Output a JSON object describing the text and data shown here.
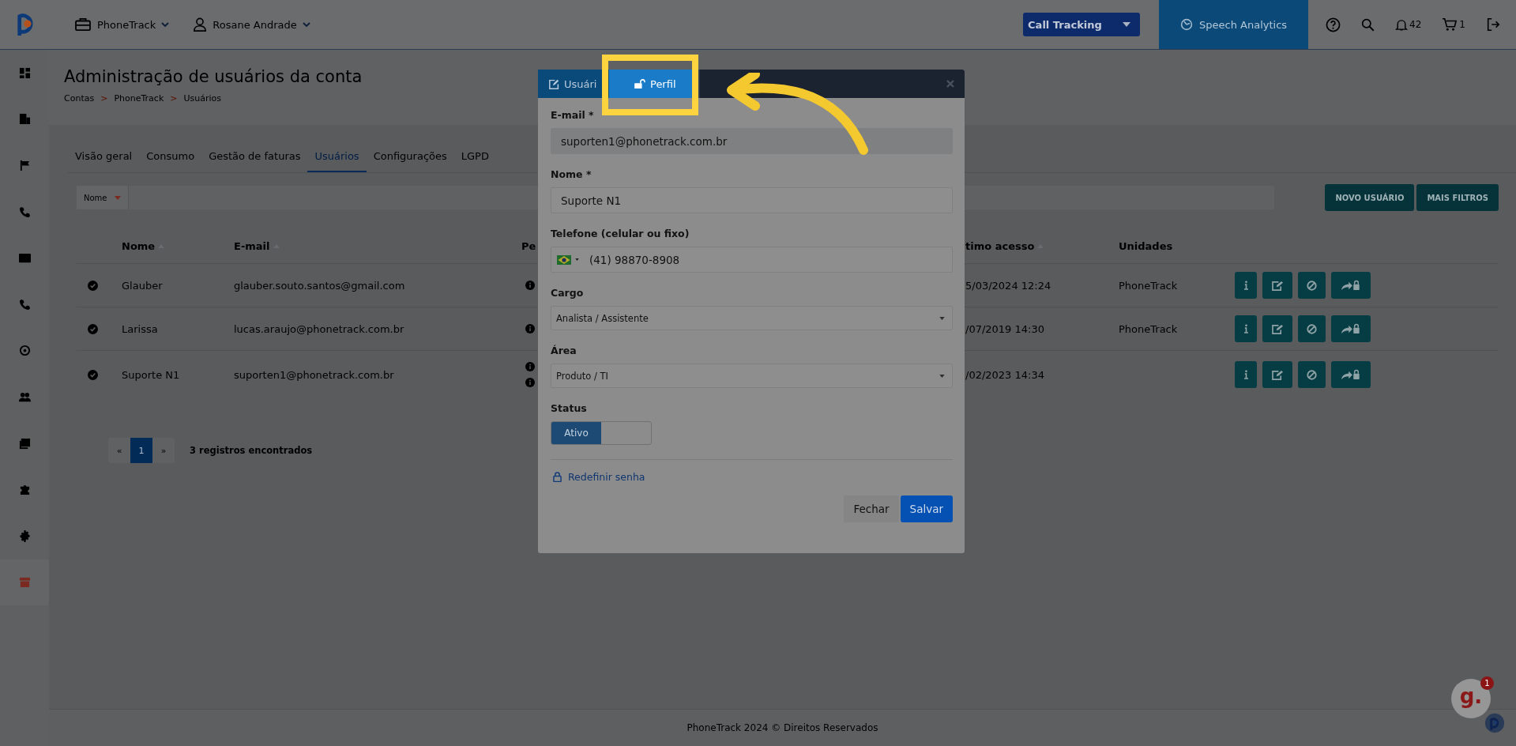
{
  "topbar": {
    "account": "PhoneTrack",
    "user": "Rosane Andrade",
    "product_select": "Call Tracking",
    "speech_button": "Speech Analytics",
    "notifications": "42",
    "cart": "1"
  },
  "page": {
    "title": "Administração de usuários da conta",
    "breadcrumb": [
      "Contas",
      "PhoneTrack",
      "Usuários"
    ],
    "breadcrumb_separator": ">"
  },
  "tabs": [
    {
      "label": "Visão geral",
      "selected": false
    },
    {
      "label": "Consumo",
      "selected": false
    },
    {
      "label": "Gestão de faturas",
      "selected": false
    },
    {
      "label": "Usuários",
      "selected": true
    },
    {
      "label": "Configurações",
      "selected": false
    },
    {
      "label": "LGPD",
      "selected": false
    }
  ],
  "filter": {
    "field": "Nome"
  },
  "actions": [
    "NOVO USUÁRIO",
    "MAIS FILTROS"
  ],
  "table": {
    "columns": [
      "Nome",
      "E-mail",
      "Pe",
      "timo acesso",
      "Unidades"
    ],
    "rows": [
      {
        "name": "Glauber",
        "email": "glauber.souto.santos@gmail.com",
        "profile_icons": [
          {
            "kind": "info"
          }
        ],
        "last_access": "5/03/2024 12:24",
        "unit": "PhoneTrack"
      },
      {
        "name": "Larissa",
        "email": "lucas.araujo@phonetrack.com.br",
        "profile_icons": [
          {
            "kind": "info"
          }
        ],
        "last_access": "/07/2019 14:30",
        "unit": "PhoneTrack"
      },
      {
        "name": "Suporte N1",
        "email": "suporten1@phonetrack.com.br",
        "profile_icons": [
          {
            "kind": "info"
          },
          {
            "kind": "info"
          }
        ],
        "last_access": "/02/2023 14:34"
      }
    ]
  },
  "pagination": {
    "prev": "«",
    "pages": [
      {
        "label": "1",
        "selected": true
      }
    ],
    "next": "»",
    "summary": "3 registros encontrados"
  },
  "modal": {
    "tabs": [
      {
        "label": "Usuári",
        "selected": false
      },
      {
        "label": "Perfil",
        "selected": true
      }
    ],
    "fields": [
      {
        "kind": "text",
        "label": "E-mail *",
        "value": "suporten1@phonetrack.com.br",
        "disabled": true
      },
      {
        "kind": "text",
        "label": "Nome *",
        "value": "Suporte N1",
        "disabled": false
      },
      {
        "kind": "phone",
        "label": "Telefone (celular ou fixo)",
        "value": "(41) 98870-8908",
        "disabled": false
      },
      {
        "kind": "select",
        "label": "Cargo",
        "value": "Analista / Assistente",
        "disabled": false
      },
      {
        "kind": "select",
        "label": "Área",
        "value": "Produto / TI",
        "disabled": false
      }
    ],
    "status": {
      "label": "Status",
      "toggle_label": "Ativo",
      "on": true
    },
    "reset_link": "Redefinir senha",
    "buttons": [
      "Fechar",
      "Salvar"
    ]
  },
  "footer": "PhoneTrack 2024 © Direitos Reservados",
  "chat_badge": {
    "letter": "g.",
    "count": "1"
  }
}
